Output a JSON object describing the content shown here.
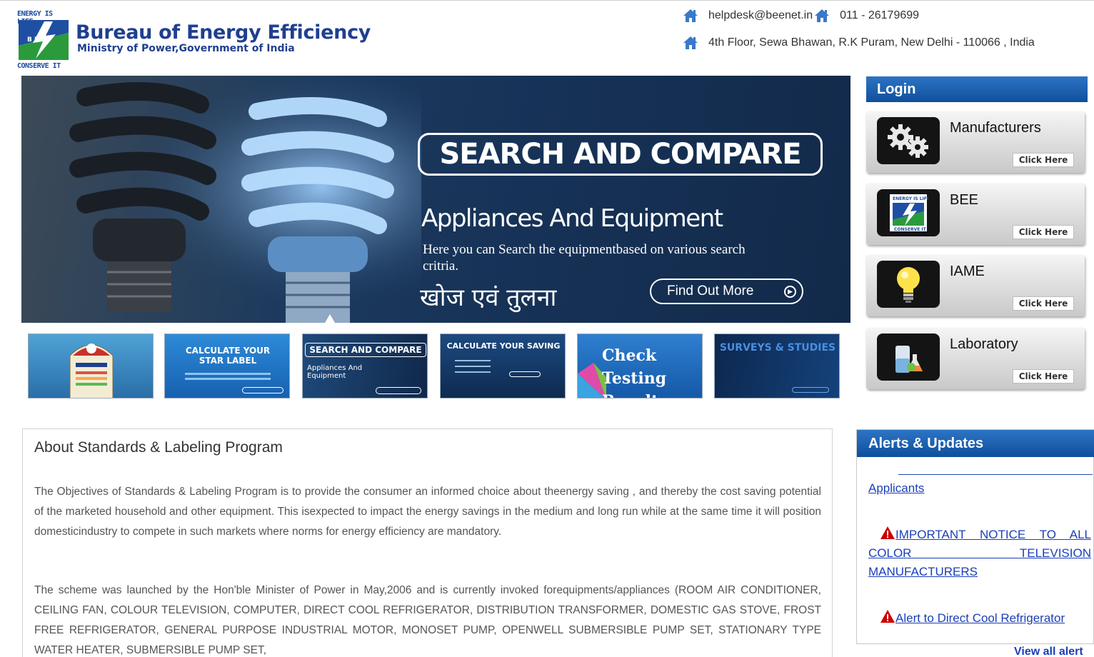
{
  "header": {
    "logo_top_text": "ENERGY IS LIFE",
    "logo_bottom_text": "CONSERVE IT",
    "org_name": "Bureau of Energy Efficiency",
    "org_subtitle": "Ministry of Power,Government of India",
    "email": "helpdesk@beenet.in",
    "phone": "011 - 26179699",
    "address": "4th Floor, Sewa Bhawan, R.K Puram, New Delhi - 110066 , India",
    "icon": "home-icon"
  },
  "banner": {
    "title": "SEARCH AND COMPARE",
    "subtitle": "Appliances And Equipment",
    "description": "Here you can Search the equipmentbased on various search critria.",
    "hindi_text": "खोज एवं तुलना",
    "button_label": "Find Out More"
  },
  "thumbnails": [
    {
      "label": ""
    },
    {
      "label": "CALCULATE YOUR STAR LABEL"
    },
    {
      "label": "SEARCH AND COMPARE",
      "sub": "Appliances And Equipment"
    },
    {
      "label": "CALCULATE YOUR SAVING"
    },
    {
      "label": "Check Testing Result"
    },
    {
      "label": "SURVEYS & STUDIES"
    }
  ],
  "login": {
    "title": "Login",
    "click_label": "Click Here",
    "items": [
      {
        "name": "Manufacturers",
        "icon": "gears-icon"
      },
      {
        "name": "BEE",
        "icon": "bee-logo-icon"
      },
      {
        "name": "IAME",
        "icon": "lightbulb-icon"
      },
      {
        "name": "Laboratory",
        "icon": "lab-flask-icon"
      }
    ]
  },
  "about": {
    "title": "About Standards & Labeling Program",
    "para1": "The Objectives of Standards & Labeling Program is to provide the consumer an informed choice about theenergy saving , and thereby the cost saving potential of the marketed household and other equipment. This isexpected to impact the energy savings in the medium and long run while at the same time it will position domesticindustry to compete in such markets where norms for energy efficiency are mandatory.",
    "para2": "The scheme was launched by the Hon'ble Minister of Power in May,2006 and is currently invoked forequipments/appliances (ROOM AIR CONDITIONER, CEILING FAN, COLOUR TELEVISION, COMPUTER, DIRECT COOL REFRIGERATOR, DISTRIBUTION TRANSFORMER, DOMESTIC GAS STOVE, FROST FREE REFRIGERATOR, GENERAL PURPOSE INDUSTRIAL MOTOR, MONOSET PUMP, OPENWELL SUBMERSIBLE PUMP SET, STATIONARY TYPE WATER HEATER, SUBMERSIBLE PUMP SET,"
  },
  "alerts": {
    "title": "Alerts & Updates",
    "applicants_link": "Applicants",
    "items": [
      "IMPORTANT NOTICE TO ALL COLOR TELEVISION MANUFACTURERS",
      "Alert to Direct Cool Refrigerator"
    ],
    "view_all": "View all alert"
  },
  "colors": {
    "brand_blue": "#1f3f8f",
    "header_bar_blue": "#0f4f9c",
    "link_blue": "#1a3fb8",
    "warning_red": "#cc0000"
  }
}
